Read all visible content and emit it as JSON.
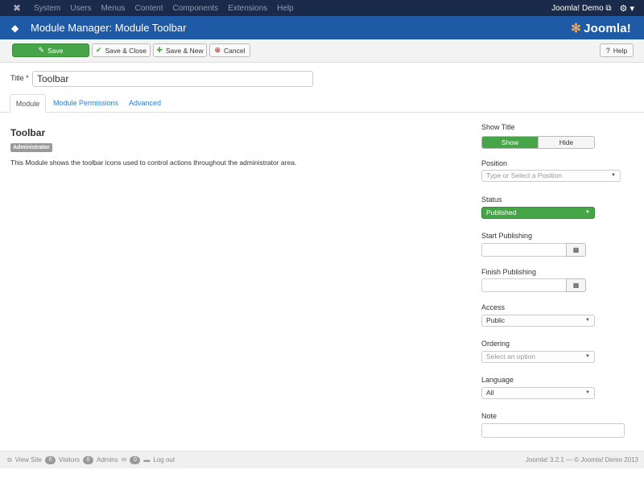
{
  "topnav": {
    "menu": [
      "System",
      "Users",
      "Menus",
      "Content",
      "Components",
      "Extensions",
      "Help"
    ],
    "user": "Joomla! Demo",
    "logo_icon": "joomla-icon",
    "settings_icon": "gear-icon"
  },
  "header": {
    "title": "Module Manager: Module Toolbar",
    "brand": "Joomla!"
  },
  "toolbar": {
    "save": "Save",
    "save_close": "Save & Close",
    "save_new": "Save & New",
    "cancel": "Cancel",
    "help": "Help"
  },
  "form": {
    "title_label": "Title *",
    "title_value": "Toolbar"
  },
  "tabs": {
    "module": "Module",
    "permissions": "Module Permissions",
    "advanced": "Advanced"
  },
  "module": {
    "name": "Toolbar",
    "badge": "Administrator",
    "description": "This Module shows the toolbar icons used to control actions throughout the administrator area."
  },
  "sidebar": {
    "show_title_label": "Show Title",
    "show_label": "Show",
    "hide_label": "Hide",
    "position_label": "Position",
    "position_placeholder": "Type or Select a Position",
    "status_label": "Status",
    "status_value": "Published",
    "start_label": "Start Publishing",
    "finish_label": "Finish Publishing",
    "access_label": "Access",
    "access_value": "Public",
    "ordering_label": "Ordering",
    "ordering_placeholder": "Select an option",
    "language_label": "Language",
    "language_value": "All",
    "note_label": "Note"
  },
  "footer": {
    "view_site": "View Site",
    "visitors_count": "0",
    "visitors": "Visitors",
    "admins_count": "0",
    "admins": "Admins",
    "messages_count": "0",
    "logout": "Log out",
    "version": "Joomla! 3.2.1 — © Joomla! Demo 2013"
  },
  "colors": {
    "nav_bg": "#1a2a4a",
    "header_bg": "#1f5aa6",
    "success": "#46a546",
    "link": "#2a7fd4"
  }
}
